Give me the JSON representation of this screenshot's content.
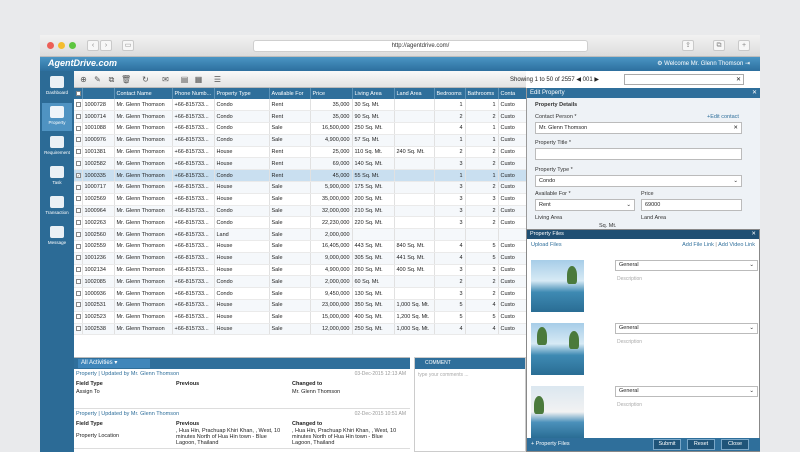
{
  "browser": {
    "url": "http://agentdrive.com/"
  },
  "app": {
    "brand": "AgentDrive.com",
    "welcome": "Welcome Mr. Glenn Thomson"
  },
  "sidebar": {
    "items": [
      {
        "label": "Dashboard"
      },
      {
        "label": "Property"
      },
      {
        "label": "Requirement"
      },
      {
        "label": "Task"
      },
      {
        "label": "Transaction"
      },
      {
        "label": "Message"
      }
    ]
  },
  "toolbar": {
    "paging": "Showing 1 to 50 of 2557",
    "page": "001",
    "search_value": ""
  },
  "grid": {
    "columns": [
      "",
      "",
      "Contact Name",
      "Phone Numb...",
      "Property Type",
      "Available For",
      "Price",
      "Living Area",
      "Land Area",
      "Bedrooms",
      "Bathrooms",
      "Conta"
    ],
    "rows": [
      [
        "1000728",
        "Mr. Glenn Thomson",
        "+66-815733...",
        "Condo",
        "Rent",
        "35,000",
        "30 Sq. Mt.",
        "",
        "1",
        "1",
        "Custo"
      ],
      [
        "1000714",
        "Mr. Glenn Thomson",
        "+66-815733...",
        "Condo",
        "Rent",
        "35,000",
        "90 Sq. Mt.",
        "",
        "2",
        "2",
        "Custo"
      ],
      [
        "1001088",
        "Mr. Glenn Thomson",
        "+66-815733...",
        "Condo",
        "Sale",
        "16,500,000",
        "250 Sq. Mt.",
        "",
        "4",
        "1",
        "Custo"
      ],
      [
        "1000976",
        "Mr. Glenn Thomson",
        "+66-815733...",
        "Condo",
        "Sale",
        "4,900,000",
        "57 Sq. Mt.",
        "",
        "1",
        "1",
        "Custo"
      ],
      [
        "1001381",
        "Mr. Glenn Thomson",
        "+66-815733...",
        "House",
        "Rent",
        "25,000",
        "110 Sq. Mt.",
        "240 Sq. Mt.",
        "2",
        "2",
        "Custo"
      ],
      [
        "1002582",
        "Mr. Glenn Thomson",
        "+66-815733...",
        "House",
        "Rent",
        "69,000",
        "140 Sq. Mt.",
        "",
        "3",
        "2",
        "Custo"
      ],
      [
        "1000335",
        "Mr. Glenn Thomson",
        "+66-815733...",
        "Condo",
        "Rent",
        "45,000",
        "55 Sq. Mt.",
        "",
        "1",
        "1",
        "Custo"
      ],
      [
        "1000717",
        "Mr. Glenn Thomson",
        "+66-815733...",
        "House",
        "Sale",
        "5,900,000",
        "175 Sq. Mt.",
        "",
        "3",
        "2",
        "Custo"
      ],
      [
        "1002569",
        "Mr. Glenn Thomson",
        "+66-815733...",
        "House",
        "Sale",
        "35,000,000",
        "200 Sq. Mt.",
        "",
        "3",
        "3",
        "Custo"
      ],
      [
        "1000964",
        "Mr. Glenn Thomson",
        "+66-815733...",
        "Condo",
        "Sale",
        "32,000,000",
        "210 Sq. Mt.",
        "",
        "3",
        "2",
        "Custo"
      ],
      [
        "1002263",
        "Mr. Glenn Thomson",
        "+66-815733...",
        "Condo",
        "Sale",
        "22,230,000",
        "220 Sq. Mt.",
        "",
        "3",
        "2",
        "Custo"
      ],
      [
        "1002560",
        "Mr. Glenn Thomson",
        "+66-815733...",
        "Land",
        "Sale",
        "2,000,000",
        "",
        "",
        "",
        "",
        ""
      ],
      [
        "1002559",
        "Mr. Glenn Thomson",
        "+66-815733...",
        "House",
        "Sale",
        "16,405,000",
        "443 Sq. Mt.",
        "840 Sq. Mt.",
        "4",
        "5",
        "Custo"
      ],
      [
        "1001236",
        "Mr. Glenn Thomson",
        "+66-815733...",
        "House",
        "Sale",
        "9,000,000",
        "305 Sq. Mt.",
        "441 Sq. Mt.",
        "4",
        "5",
        "Custo"
      ],
      [
        "1002134",
        "Mr. Glenn Thomson",
        "+66-815733...",
        "House",
        "Sale",
        "4,900,000",
        "260 Sq. Mt.",
        "400 Sq. Mt.",
        "3",
        "3",
        "Custo"
      ],
      [
        "1002085",
        "Mr. Glenn Thomson",
        "+66-815733...",
        "Condo",
        "Sale",
        "2,000,000",
        "60 Sq. Mt.",
        "",
        "2",
        "2",
        "Custo"
      ],
      [
        "1000936",
        "Mr. Glenn Thomson",
        "+66-815733...",
        "Condo",
        "Sale",
        "9,450,000",
        "130 Sq. Mt.",
        "",
        "3",
        "2",
        "Custo"
      ],
      [
        "1002531",
        "Mr. Glenn Thomson",
        "+66-815733...",
        "House",
        "Sale",
        "23,000,000",
        "350 Sq. Mt.",
        "1,000 Sq. Mt.",
        "5",
        "4",
        "Custo"
      ],
      [
        "1002523",
        "Mr. Glenn Thomson",
        "+66-815733...",
        "House",
        "Sale",
        "15,000,000",
        "400 Sq. Mt.",
        "1,200 Sq. Mt.",
        "5",
        "5",
        "Custo"
      ],
      [
        "1002538",
        "Mr. Glenn Thomson",
        "+66-815733...",
        "House",
        "Sale",
        "12,000,000",
        "250 Sq. Mt.",
        "1,000 Sq. Mt.",
        "4",
        "4",
        "Custo"
      ]
    ],
    "selected_index": 6
  },
  "activity": {
    "filter": "All Activities",
    "entries": [
      {
        "head": "Property | Updated by Mr. Glenn Thomson",
        "date": "03-Dec-2015 12:13 AM",
        "field_label": "Field Type",
        "prev_label": "Previous",
        "changed_label": "Changed to",
        "field": "Assign To",
        "previous": "",
        "changed": "Mr. Glenn Thomson"
      },
      {
        "head": "Property | Updated by Mr. Glenn Thomson",
        "date": "02-Dec-2015 10:51 AM",
        "field_label": "Field Type",
        "prev_label": "Previous",
        "changed_label": "Changed to",
        "field": "Property Location",
        "previous": ", Hua Hin, Prachuap Khiri Khan, , West, 10 minutes North of Hua Hin town - Blue Lagoon, Thailand",
        "changed": ", Hua Hin, Prachuap Khiri Khan, , West, 10 minutes North of Hua Hin town - Blue Lagoon, Thailand"
      }
    ]
  },
  "comment": {
    "title": "COMMENT",
    "placeholder": "type your comments ..."
  },
  "edit": {
    "title": "Edit Property",
    "section": "Property Details",
    "contact_label": "Contact Person *",
    "edit_contact": "Edit contact",
    "contact_value": "Mr. Glenn Thomson",
    "title_label": "Property Title *",
    "type_label": "Property Type *",
    "type_value": "Condo",
    "available_label": "Available For *",
    "available_value": "Rent",
    "price_label": "Price",
    "price_value": "69000",
    "living_label": "Living Area",
    "land_label": "Land Area",
    "living_value": "Sq. Mt."
  },
  "files": {
    "title": "Property Files",
    "upload": "Upload Files",
    "add_file": "Add File Link",
    "sep": "|",
    "add_video": "Add Video Link",
    "items": [
      {
        "type": "General",
        "desc": "Description"
      },
      {
        "type": "General",
        "desc": "Description"
      },
      {
        "type": "General",
        "desc": "Description"
      }
    ],
    "footer_link": "+ Property Files",
    "submit": "Submit",
    "reset": "Reset",
    "close": "Close"
  },
  "colors": {
    "header_blue": "#2f6f9b",
    "sidebar_blue": "#2c6b96",
    "selected_row": "#c9dff0"
  }
}
